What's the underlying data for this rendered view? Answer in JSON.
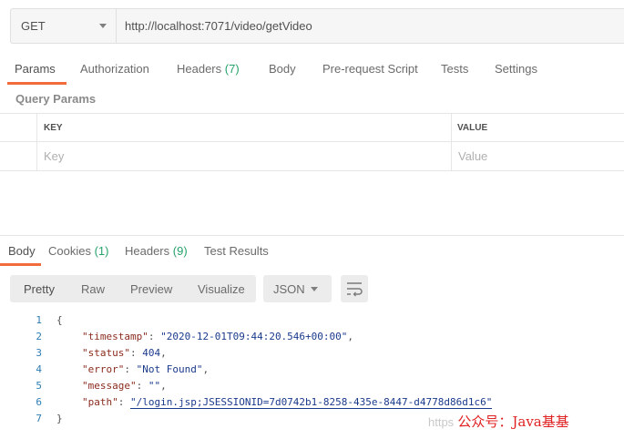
{
  "request": {
    "method": "GET",
    "url": "http://localhost:7071/video/getVideo"
  },
  "request_tabs": [
    {
      "label": "Params",
      "count": ""
    },
    {
      "label": "Authorization",
      "count": ""
    },
    {
      "label": "Headers",
      "count": "(7)"
    },
    {
      "label": "Body",
      "count": ""
    },
    {
      "label": "Pre-request Script",
      "count": ""
    },
    {
      "label": "Tests",
      "count": ""
    },
    {
      "label": "Settings",
      "count": ""
    }
  ],
  "query_params": {
    "title": "Query Params",
    "col_key": "KEY",
    "col_value": "VALUE",
    "key_placeholder": "Key",
    "value_placeholder": "Value"
  },
  "response_tabs": [
    {
      "label": "Body",
      "count": ""
    },
    {
      "label": "Cookies",
      "count": "(1)"
    },
    {
      "label": "Headers",
      "count": "(9)"
    },
    {
      "label": "Test Results",
      "count": ""
    }
  ],
  "view_modes": [
    "Pretty",
    "Raw",
    "Preview",
    "Visualize"
  ],
  "format": "JSON",
  "code": {
    "line_numbers": [
      "1",
      "2",
      "3",
      "4",
      "5",
      "6",
      "7"
    ],
    "open_brace": "{",
    "close_brace": "}",
    "fields": [
      {
        "key": "\"timestamp\"",
        "value": "\"2020-12-01T09:44:20.546+00:00\""
      },
      {
        "key": "\"status\"",
        "value": "404"
      },
      {
        "key": "\"error\"",
        "value": "\"Not Found\""
      },
      {
        "key": "\"message\"",
        "value": "\"\""
      },
      {
        "key": "\"path\"",
        "value": "\"/login.jsp;JSESSIONID=7d0742b1-8258-435e-8447-d4778d86d1c6\""
      }
    ]
  },
  "watermark": {
    "url_text": "https",
    "text": "公众号：Java基基"
  },
  "colors": {
    "accent": "#f26b3a",
    "count_green": "#26a26b",
    "json_key": "#8b2b1e",
    "json_value": "#1a3a8c"
  }
}
